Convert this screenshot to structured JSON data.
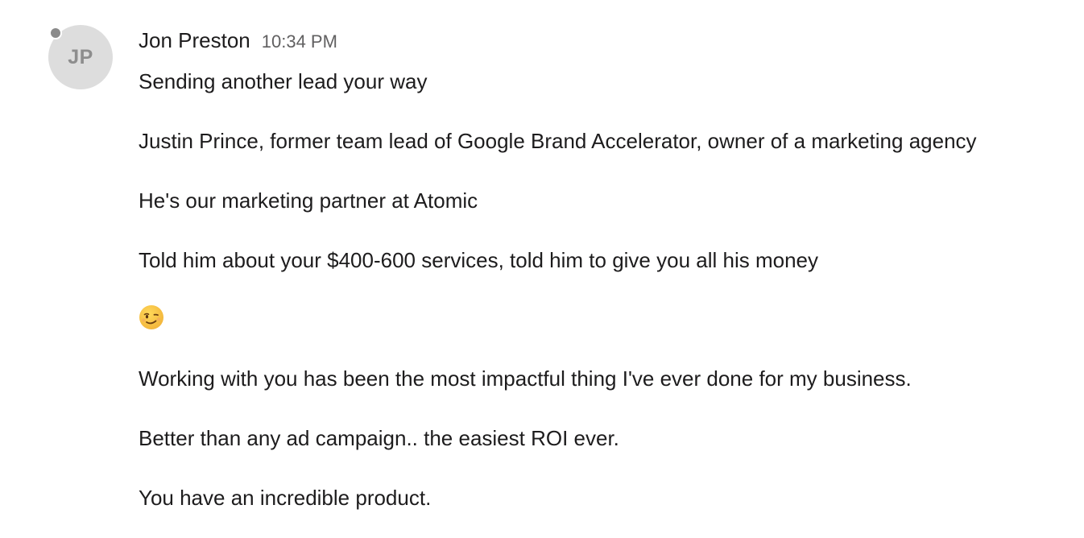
{
  "sender": {
    "name": "Jon Preston",
    "initials": "JP",
    "timestamp": "10:34 PM"
  },
  "message": {
    "lines": [
      "Sending another lead your way",
      "Justin Prince, former team lead of Google Brand Accelerator, owner of a marketing agency",
      "He's our marketing partner at Atomic",
      "Told him about your $400-600 services, told him to give you all his money",
      "Working with you has been the most impactful thing I've ever done for my business.",
      "Better than any ad campaign.. the easiest ROI ever.",
      "You have an incredible product."
    ],
    "emoji": "winking-face-icon"
  },
  "colors": {
    "avatar_bg": "#dddddd",
    "avatar_text": "#8d8d8d",
    "presence": "#8a8a8a",
    "timestamp": "#616061",
    "text": "#1d1c1d"
  }
}
